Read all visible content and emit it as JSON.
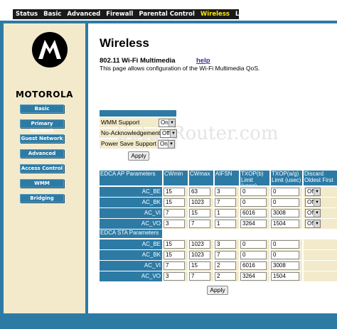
{
  "nav": {
    "items": [
      "Status",
      "Basic",
      "Advanced",
      "Firewall",
      "Parental Control",
      "Wireless",
      "Logout"
    ],
    "active": "Wireless"
  },
  "brand": {
    "logo_text": "MOTOROLA"
  },
  "sidebar": {
    "items": [
      "Basic",
      "Primary Network",
      "Guest Network",
      "Advanced",
      "Access Control",
      "WMM",
      "Bridging"
    ]
  },
  "page": {
    "title": "Wireless",
    "section": "802.11 Wi-Fi Multimedia",
    "help": "help",
    "description": "This page allows configuration of the Wi-Fi Multimedia QoS.",
    "watermark": "SetupRouter.com"
  },
  "wmm": {
    "fields": [
      {
        "label": "WMM Support",
        "value": "On"
      },
      {
        "label": "No-Acknowledgement",
        "value": "Off"
      },
      {
        "label": "Power Save Support",
        "value": "On"
      }
    ],
    "apply": "Apply"
  },
  "edca": {
    "ap_header": "EDCA AP Parameters",
    "sta_header": "EDCA STA Parameters",
    "columns": [
      "CWmin",
      "CWmax",
      "AIFSN",
      "TXOP(b) Limit (usec)",
      "TXOP(a/g) Limit (usec)",
      "Discard Oldest First"
    ],
    "ap_rows": [
      {
        "label": "AC_BE",
        "values": [
          "15",
          "63",
          "3",
          "0",
          "0"
        ],
        "discard": "Off"
      },
      {
        "label": "AC_BK",
        "values": [
          "15",
          "1023",
          "7",
          "0",
          "0"
        ],
        "discard": "Off"
      },
      {
        "label": "AC_VI",
        "values": [
          "7",
          "15",
          "1",
          "6016",
          "3008"
        ],
        "discard": "Off"
      },
      {
        "label": "AC_VO",
        "values": [
          "3",
          "7",
          "1",
          "3264",
          "1504"
        ],
        "discard": "Off"
      }
    ],
    "sta_rows": [
      {
        "label": "AC_BE",
        "values": [
          "15",
          "1023",
          "3",
          "0",
          "0"
        ]
      },
      {
        "label": "AC_BK",
        "values": [
          "15",
          "1023",
          "7",
          "0",
          "0"
        ]
      },
      {
        "label": "AC_VI",
        "values": [
          "7",
          "15",
          "2",
          "6016",
          "3008"
        ]
      },
      {
        "label": "AC_VO",
        "values": [
          "3",
          "7",
          "2",
          "3264",
          "1504"
        ]
      }
    ],
    "apply": "Apply"
  },
  "colors": {
    "accent": "#2d7ba5",
    "panel": "#f2eacb",
    "active_nav": "#ffe800"
  }
}
